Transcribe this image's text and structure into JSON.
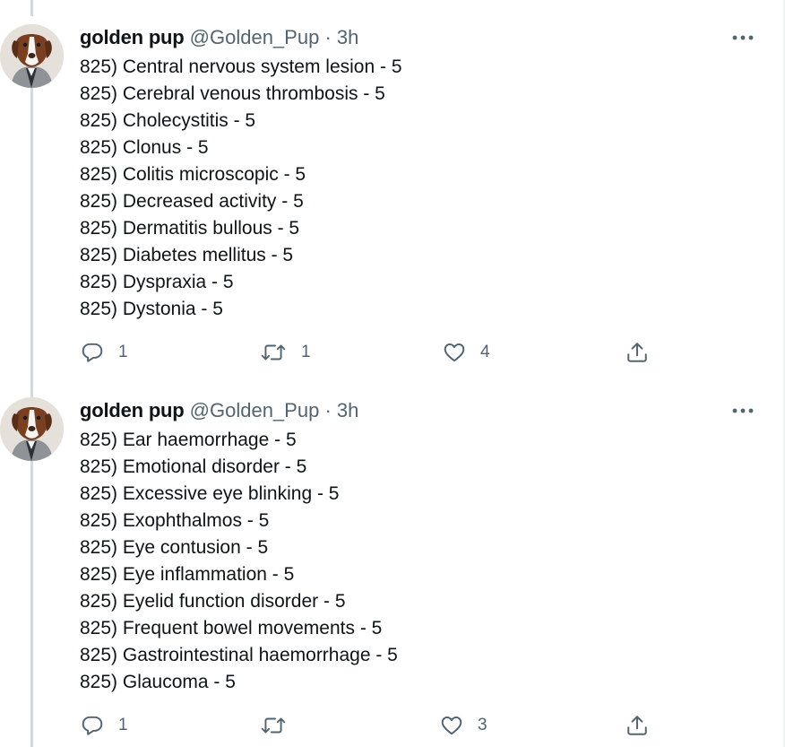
{
  "tweets": [
    {
      "author": {
        "name": "golden pup",
        "handle": "@Golden_Pup",
        "separator": "·",
        "time": "3h"
      },
      "lines": [
        "825) Central nervous system lesion - 5",
        "825) Cerebral venous thrombosis - 5",
        "825) Cholecystitis - 5",
        "825) Clonus - 5",
        "825) Colitis microscopic - 5",
        "825) Decreased activity - 5",
        "825) Dermatitis bullous - 5",
        "825) Diabetes mellitus - 5",
        "825) Dyspraxia - 5",
        "825) Dystonia - 5"
      ],
      "actions": {
        "reply_count": "1",
        "retweet_count": "1",
        "like_count": "4"
      }
    },
    {
      "author": {
        "name": "golden pup",
        "handle": "@Golden_Pup",
        "separator": "·",
        "time": "3h"
      },
      "lines": [
        "825) Ear haemorrhage - 5",
        "825) Emotional disorder - 5",
        "825) Excessive eye blinking - 5",
        "825) Exophthalmos - 5",
        "825) Eye contusion - 5",
        "825) Eye inflammation - 5",
        "825) Eyelid function disorder - 5",
        "825) Frequent bowel movements - 5",
        "825) Gastrointestinal haemorrhage - 5",
        "825) Glaucoma - 5"
      ],
      "actions": {
        "reply_count": "1",
        "retweet_count": "",
        "like_count": "3"
      }
    }
  ],
  "icons": {
    "more": "more-horizontal-icon",
    "reply": "reply-icon",
    "retweet": "retweet-icon",
    "like": "heart-icon",
    "share": "share-icon"
  },
  "colors": {
    "text": "#0f1419",
    "secondary": "#536471",
    "thread_line": "#cfd9de"
  }
}
